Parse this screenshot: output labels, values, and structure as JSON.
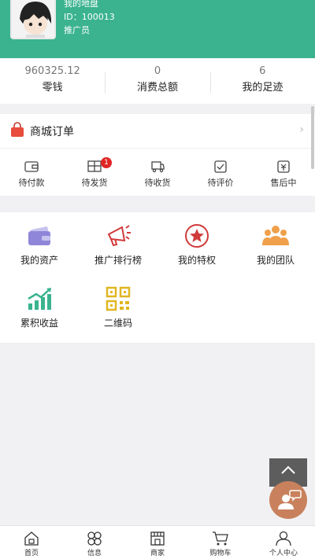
{
  "user": {
    "name": "我的地盘",
    "id_text": "ID：100013",
    "role": "推广员"
  },
  "stats": [
    {
      "value": "960325.12",
      "label": "零钱"
    },
    {
      "value": "0",
      "label": "消费总额"
    },
    {
      "value": "6",
      "label": "我的足迹"
    }
  ],
  "orders": {
    "title": "商城订单",
    "items": [
      {
        "label": "待付款",
        "icon": "wallet-icon"
      },
      {
        "label": "待发货",
        "icon": "package-icon",
        "badge": "1"
      },
      {
        "label": "待收货",
        "icon": "truck-icon"
      },
      {
        "label": "待评价",
        "icon": "review-icon"
      },
      {
        "label": "售后中",
        "icon": "after-sale-icon"
      }
    ]
  },
  "features": [
    {
      "label": "我的资产",
      "icon": "assets-icon"
    },
    {
      "label": "推广排行榜",
      "icon": "megaphone-icon"
    },
    {
      "label": "我的特权",
      "icon": "star-badge-icon"
    },
    {
      "label": "我的团队",
      "icon": "team-icon"
    },
    {
      "label": "累积收益",
      "icon": "growth-chart-icon"
    },
    {
      "label": "二维码",
      "icon": "qr-code-icon"
    }
  ],
  "tabbar": [
    {
      "label": "首页",
      "icon": "home-icon"
    },
    {
      "label": "信息",
      "icon": "info-icon"
    },
    {
      "label": "商家",
      "icon": "store-icon"
    },
    {
      "label": "购物车",
      "icon": "cart-icon"
    },
    {
      "label": "个人中心",
      "icon": "user-icon"
    }
  ],
  "colors": {
    "header": "#3ab38e",
    "badge": "#e02525",
    "support_button": "#c8815c"
  }
}
